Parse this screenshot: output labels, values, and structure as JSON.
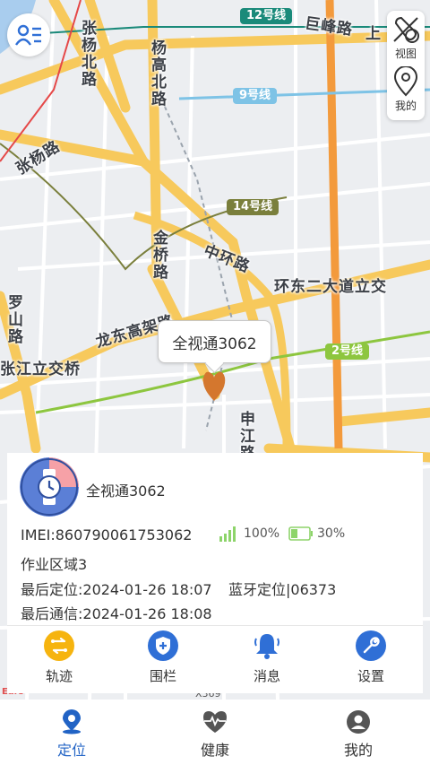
{
  "map": {
    "roads": {
      "zhangyang_bei": "张杨北路",
      "yanggao_bei": "杨高北路",
      "zhangyang": "张杨路",
      "jufeng": "巨峰路",
      "jufeng_suffix": "上",
      "jinqiao": "金桥路",
      "zhonghuan": "中环路",
      "huandong": "环东二大道立交",
      "luoshan": "罗山路",
      "longdong": "龙东高架路",
      "jiangli": "张江立交桥",
      "shenjiang": "申江路"
    },
    "metro": {
      "l12": "12号线",
      "l9": "9号线",
      "l14": "14号线",
      "l2": "2号线"
    },
    "bottom_marks": {
      "left": "Ears",
      "x369": "X369"
    }
  },
  "controls": {
    "view_label": "视图",
    "mine_label": "我的"
  },
  "marker": {
    "bubble_text": "全视通3062"
  },
  "device": {
    "name": "全视通3062",
    "imei": "IMEI:860790061753062",
    "signal": "100%",
    "battery": "30%",
    "area": "作业区域3",
    "last_location": "最后定位:2024-01-26 18:07",
    "location_mode": "蓝牙定位|06373",
    "last_comm": "最后通信:2024-01-26 18:08"
  },
  "actions": [
    {
      "label": "轨迹",
      "color": "#f6b40f"
    },
    {
      "label": "围栏",
      "color": "#2f6fd6"
    },
    {
      "label": "消息",
      "color": "#2f6fd6"
    },
    {
      "label": "设置",
      "color": "#2f6fd6"
    }
  ],
  "tabs": [
    {
      "label": "定位",
      "icon": "location-icon",
      "active": true
    },
    {
      "label": "健康",
      "icon": "heart-pulse-icon",
      "active": false
    },
    {
      "label": "我的",
      "icon": "user-icon",
      "active": false
    }
  ],
  "colors": {
    "accent": "#2163c5",
    "road_major": "#f7c95c",
    "metro12": "#1a8a7a",
    "metro9": "#7ec3e6",
    "metro14": "#7a7f3c",
    "metro2": "#8dc63f",
    "pin": "#d4772e"
  }
}
